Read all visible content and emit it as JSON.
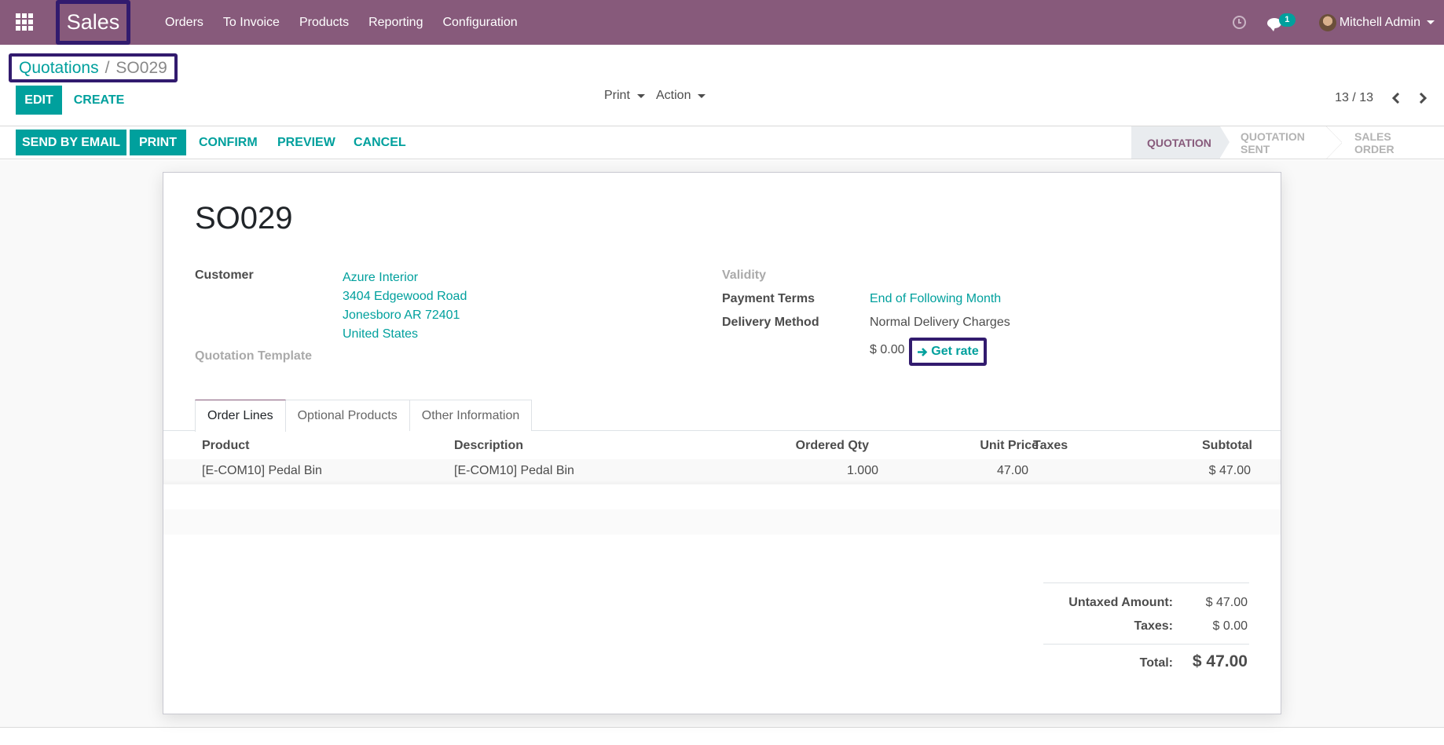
{
  "navbar": {
    "app_name": "Sales",
    "menu": [
      "Orders",
      "To Invoice",
      "Products",
      "Reporting",
      "Configuration"
    ],
    "activity_icon": "clock-icon",
    "messages_icon": "chat-icon",
    "messages_count": "1",
    "user_name": "Mitchell Admin"
  },
  "breadcrumb": {
    "parent": "Quotations",
    "separator": "/",
    "current": "SO029"
  },
  "control_panel": {
    "edit_label": "Edit",
    "create_label": "Create",
    "print_dropdown": "Print",
    "action_dropdown": "Action",
    "pager": "13 / 13"
  },
  "header_buttons": {
    "send_by_email": "Send by Email",
    "print": "Print",
    "confirm": "Confirm",
    "preview": "Preview",
    "cancel": "Cancel"
  },
  "statusbar": {
    "stages": [
      "Quotation",
      "Quotation Sent",
      "Sales Order"
    ],
    "active": "Quotation"
  },
  "form": {
    "title": "SO029",
    "customer_label": "Customer",
    "customer": {
      "name": "Azure Interior",
      "street": "3404 Edgewood Road",
      "city_line": "Jonesboro AR 72401",
      "country": "United States"
    },
    "quotation_template_label": "Quotation Template",
    "validity_label": "Validity",
    "payment_terms_label": "Payment Terms",
    "payment_terms": "End of Following Month",
    "delivery_method_label": "Delivery Method",
    "delivery_method": "Normal Delivery Charges",
    "delivery_rate": "$ 0.00",
    "get_rate_label": "Get rate"
  },
  "tabs": [
    "Order Lines",
    "Optional Products",
    "Other Information"
  ],
  "order_lines": {
    "columns": [
      "Product",
      "Description",
      "Ordered Qty",
      "Unit Price",
      "Taxes",
      "Subtotal"
    ],
    "rows": [
      {
        "product": "[E-COM10] Pedal Bin",
        "description": "[E-COM10] Pedal Bin",
        "qty": "1.000",
        "unit_price": "47.00",
        "taxes": "",
        "subtotal": "$ 47.00"
      }
    ]
  },
  "totals": {
    "untaxed_label": "Untaxed Amount:",
    "untaxed": "$ 47.00",
    "taxes_label": "Taxes:",
    "taxes": "$ 0.00",
    "total_label": "Total:",
    "total": "$ 47.00"
  },
  "colors": {
    "brand": "#875a7b",
    "accent": "#00a09d",
    "highlight_box": "#321b6e"
  }
}
